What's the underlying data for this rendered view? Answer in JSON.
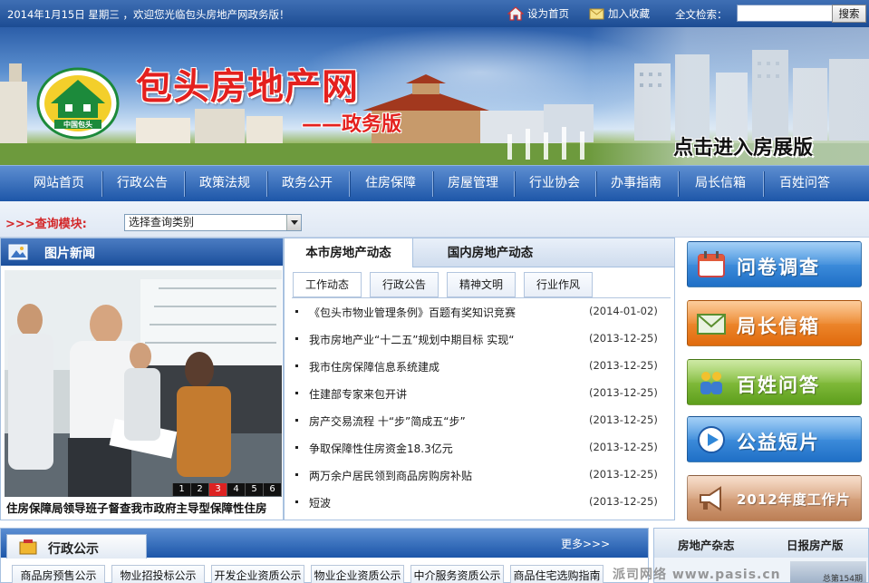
{
  "topbar": {
    "date_greeting": "2014年1月15日  星期三 ，欢迎您光临包头房地产网政务版！",
    "set_home": "设为首页",
    "add_favorite": "加入收藏",
    "search_label": "全文检索：",
    "search_value": "",
    "search_button": "搜索"
  },
  "banner": {
    "site_title": "包头房地产网",
    "subtitle": "——政务版",
    "logo_text": "中国包头",
    "enter_expo": "点击进入房展版"
  },
  "nav": {
    "items": [
      "网站首页",
      "行政公告",
      "政策法规",
      "政务公开",
      "住房保障",
      "房屋管理",
      "行业协会",
      "办事指南",
      "局长信箱",
      "百姓问答"
    ]
  },
  "query": {
    "label": ">>>查询模块:",
    "select_value": "选择查询类别"
  },
  "picture_news": {
    "title": "图片新闻",
    "pages": [
      "1",
      "2",
      "3",
      "4",
      "5",
      "6"
    ],
    "active_page": "3",
    "caption": "住房保障局领导班子督查我市政府主导型保障性住房"
  },
  "news": {
    "tabs": [
      "本市房地产动态",
      "国内房地产动态"
    ],
    "subtabs": [
      "工作动态",
      "行政公告",
      "精神文明",
      "行业作风"
    ],
    "items": [
      {
        "title": "《包头市物业管理条例》百题有奖知识竞赛",
        "date": "(2014-01-02)"
      },
      {
        "title": "我市房地产业“十二五”规划中期目标 实现“",
        "date": "(2013-12-25)"
      },
      {
        "title": "我市住房保障信息系统建成",
        "date": "(2013-12-25)"
      },
      {
        "title": "住建部专家来包开讲",
        "date": "(2013-12-25)"
      },
      {
        "title": "房产交易流程 十“步”简成五“步”",
        "date": "(2013-12-25)"
      },
      {
        "title": "争取保障性住房资金18.3亿元",
        "date": "(2013-12-25)"
      },
      {
        "title": "两万余户居民领到商品房购房补贴",
        "date": "(2013-12-25)"
      },
      {
        "title": "短波",
        "date": "(2013-12-25)"
      }
    ]
  },
  "side_buttons": {
    "survey": "问卷调查",
    "director_mailbox": "局长信箱",
    "qa": "百姓问答",
    "psa": "公益短片",
    "annual_report": "2012年度工作片"
  },
  "admin_notice": {
    "title": "行政公示",
    "more": "更多>>>",
    "tabs": [
      "商品房预售公示",
      "物业招投标公示",
      "开发企业资质公示",
      "物业企业资质公示",
      "中介服务资质公示",
      "商品住宅选购指南"
    ]
  },
  "magazine": {
    "tab1": "房地产杂志",
    "tab2": "日报房产版",
    "issue": "总第154期"
  },
  "watermark": "派司网络 www.pasis.cn",
  "colors": {
    "nav_blue": "#1d56a8",
    "title_red": "#e4201e",
    "survey_blue": "#2f87d8",
    "mailbox_orange": "#ef7a14",
    "qa_green": "#79b92a",
    "psa_blue": "#2f87d8",
    "annual_tan": "#c8916b"
  }
}
